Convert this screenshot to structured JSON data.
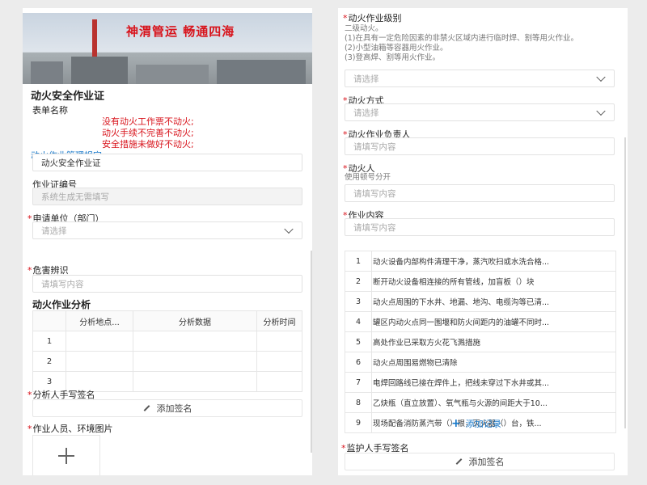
{
  "left": {
    "banner_slogan": "神渭管运    畅通四海",
    "form_title": "动火安全作业证",
    "form_name_label": "表单名称",
    "warnings": [
      "没有动火工作票不动火;",
      "动火手续不完善不动火;",
      "安全措施未做好不动火;"
    ],
    "rules_link": "动火作业管理规定",
    "form_name_value": "动火安全作业证",
    "permit_no_label": "作业证编号",
    "permit_no_placeholder": "系统生成无需填写",
    "applicant_unit_label": "申请单位（部门）",
    "applicant_unit_placeholder": "请选择",
    "hazard_label": "危害辨识",
    "hazard_placeholder": "请填写内容",
    "analysis_title": "动火作业分析",
    "analysis_headers": [
      "分析地点...",
      "分析数据",
      "分析时间"
    ],
    "analysis_rows": [
      "1",
      "2",
      "3"
    ],
    "analyst_sign_label": "分析人手写签名",
    "add_signature": "添加签名",
    "photos_label": "作业人员、环境图片"
  },
  "right": {
    "level_label": "动火作业级别",
    "level_desc": [
      "二级动火。",
      "(1)在具有一定危险因素的非禁火区域内进行临时焊、割等用火作业。",
      "(2)小型油箱等容器用火作业。",
      "(3)登高焊、割等用火作业。"
    ],
    "level_placeholder": "请选择",
    "method_label": "动火方式",
    "method_placeholder": "请选择",
    "owner_label": "动火作业负责人",
    "owner_placeholder": "请填写内容",
    "worker_label": "动火人",
    "worker_hint": "使用顿号分开",
    "worker_placeholder": "请填写内容",
    "content_label": "作业内容",
    "content_placeholder": "请填写内容",
    "checklist": [
      {
        "n": "1",
        "text": "动火设备内部构件清理干净，蒸汽吹扫或水洗合格..."
      },
      {
        "n": "2",
        "text": "断开动火设备相连接的所有管线，加盲板（）块"
      },
      {
        "n": "3",
        "text": "动火点周围的下水井、地漏、地沟、电缆沟等已清..."
      },
      {
        "n": "4",
        "text": "罐区内动火点同一围堰和防火间距内的油罐不同时..."
      },
      {
        "n": "5",
        "text": "高处作业已采取方火花飞溅措施"
      },
      {
        "n": "6",
        "text": "动火点周围易燃物已清除"
      },
      {
        "n": "7",
        "text": "电焊回路线已接在焊件上，把线未穿过下水井或其..."
      },
      {
        "n": "8",
        "text": "乙炔瓶（直立放置）、氧气瓶与火源的间距大于10..."
      },
      {
        "n": "9",
        "text": "现场配备消防蒸汽带（）根，灭火器（）台，铁..."
      }
    ],
    "add_record": "添加记录",
    "supervisor_sign_label": "监护人手写签名",
    "add_signature": "添加签名"
  },
  "colors": {
    "required": "#d8131b",
    "link": "#1677c8",
    "banner_text": "#d8131b"
  }
}
